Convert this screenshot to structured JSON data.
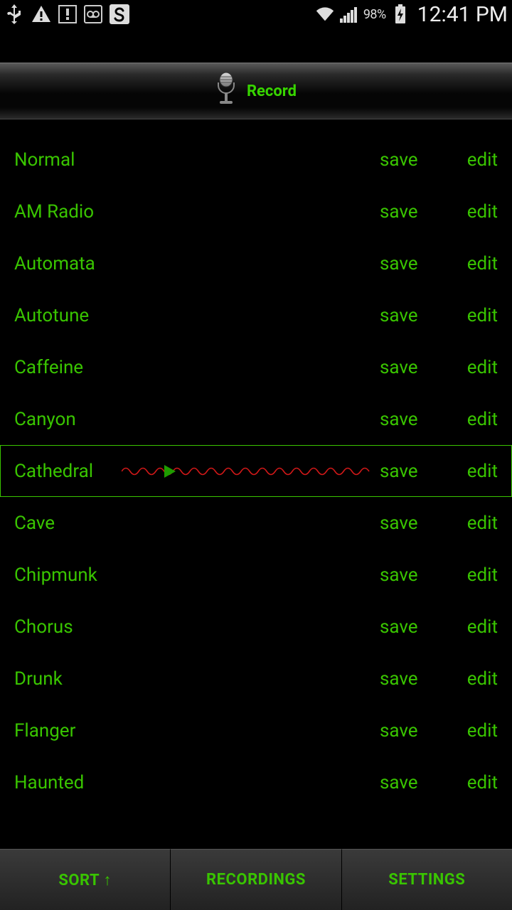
{
  "status": {
    "battery": "98%",
    "clock": "12:41 PM"
  },
  "record": {
    "label": "Record"
  },
  "effects": [
    {
      "name": "Normal",
      "selected": false
    },
    {
      "name": "AM Radio",
      "selected": false
    },
    {
      "name": "Automata",
      "selected": false
    },
    {
      "name": "Autotune",
      "selected": false
    },
    {
      "name": "Caffeine",
      "selected": false
    },
    {
      "name": "Canyon",
      "selected": false
    },
    {
      "name": "Cathedral",
      "selected": true
    },
    {
      "name": "Cave",
      "selected": false
    },
    {
      "name": "Chipmunk",
      "selected": false
    },
    {
      "name": "Chorus",
      "selected": false
    },
    {
      "name": "Drunk",
      "selected": false
    },
    {
      "name": "Flanger",
      "selected": false
    },
    {
      "name": "Haunted",
      "selected": false
    }
  ],
  "row_actions": {
    "save": "save",
    "edit": "edit"
  },
  "bottom": {
    "sort": "SORT ↑",
    "recordings": "RECORDINGS",
    "settings": "SETTINGS"
  }
}
